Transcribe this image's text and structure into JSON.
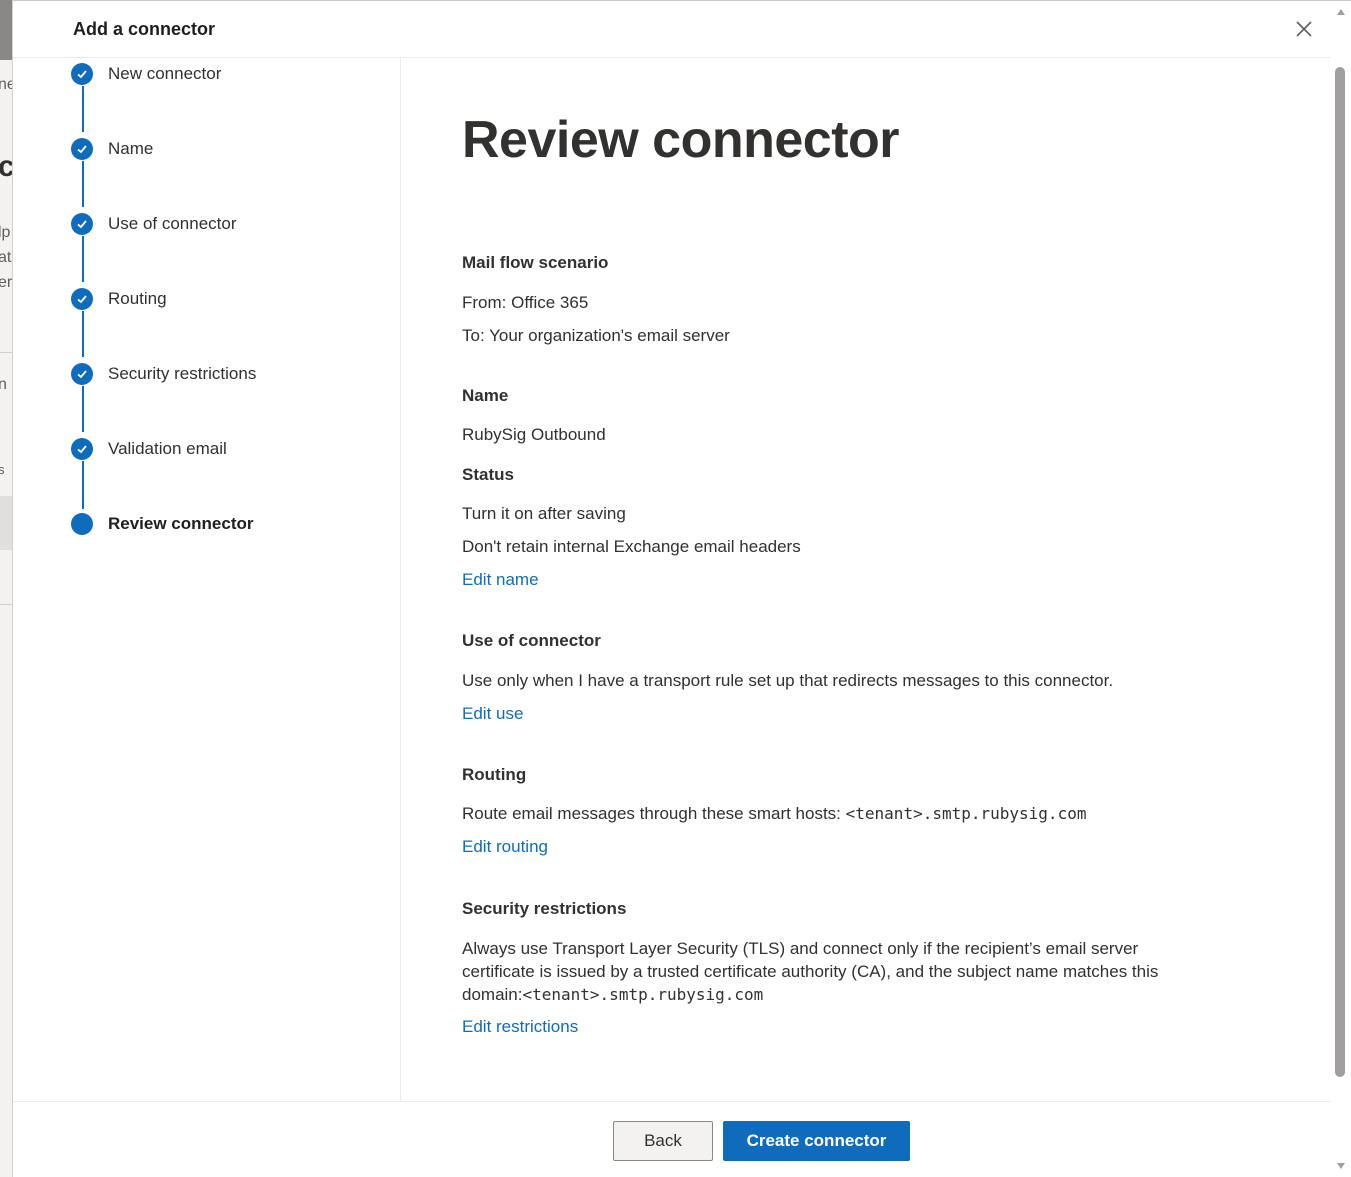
{
  "background_fragments": [
    "ne",
    "c",
    "lp",
    "at",
    "er",
    "n",
    "s"
  ],
  "dialog": {
    "title": "Add a connector",
    "close_icon": "close-icon"
  },
  "steps": [
    {
      "label": "New connector",
      "state": "complete"
    },
    {
      "label": "Name",
      "state": "complete"
    },
    {
      "label": "Use of connector",
      "state": "complete"
    },
    {
      "label": "Routing",
      "state": "complete"
    },
    {
      "label": "Security restrictions",
      "state": "complete"
    },
    {
      "label": "Validation email",
      "state": "complete"
    },
    {
      "label": "Review connector",
      "state": "current"
    }
  ],
  "review": {
    "title": "Review connector",
    "mail_flow": {
      "heading": "Mail flow scenario",
      "from": "From: Office 365",
      "to": "To: Your organization's email server"
    },
    "name": {
      "heading": "Name",
      "value": "RubySig Outbound"
    },
    "status": {
      "heading": "Status",
      "line1": "Turn it on after saving",
      "line2": "Don't retain internal Exchange email headers",
      "edit_link": "Edit name"
    },
    "use": {
      "heading": "Use of connector",
      "value": "Use only when I have a transport rule set up that redirects messages to this connector.",
      "edit_link": "Edit use"
    },
    "routing": {
      "heading": "Routing",
      "prefix": "Route email messages through these smart hosts:",
      "host": "<tenant>.smtp.rubysig.com",
      "edit_link": "Edit routing"
    },
    "security": {
      "heading": "Security restrictions",
      "text": "Always use Transport Layer Security (TLS) and connect only if the recipient’s email server certificate is issued by a trusted certificate authority (CA), and the subject name matches this domain:",
      "domain": "<tenant>.smtp.rubysig.com",
      "edit_link": "Edit restrictions"
    }
  },
  "footer": {
    "back_label": "Back",
    "create_label": "Create connector"
  },
  "colors": {
    "accent": "#0f6cbd",
    "text": "#323130",
    "button_secondary_bg": "#f3f2f1"
  }
}
